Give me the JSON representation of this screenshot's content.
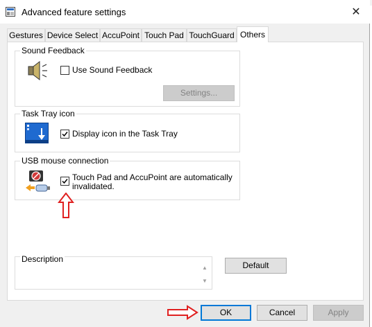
{
  "window": {
    "title": "Advanced feature settings",
    "close_glyph": "✕"
  },
  "tabs": [
    "Gestures",
    "Device Select",
    "AccuPoint",
    "Touch Pad",
    "TouchGuard",
    "Others"
  ],
  "active_tab": "Others",
  "sound": {
    "group_label": "Sound Feedback",
    "checkbox_label": "Use Sound Feedback",
    "checked": false,
    "settings_button": "Settings...",
    "icon": "speaker-icon"
  },
  "tray": {
    "group_label": "Task Tray icon",
    "checkbox_label": "Display icon in the Task Tray",
    "checked": true,
    "icon": "task-tray-icon"
  },
  "usb": {
    "group_label": "USB mouse connection",
    "checkbox_line1": "Touch Pad and AccuPoint are automatically",
    "checkbox_line2": "invalidated.",
    "checked": true,
    "icon": "usb-mouse-icon"
  },
  "description": {
    "label": "Description"
  },
  "buttons": {
    "default": "Default",
    "ok": "OK",
    "cancel": "Cancel",
    "apply": "Apply"
  },
  "annotation_color": "#e02020",
  "accent_color": "#0078d7"
}
